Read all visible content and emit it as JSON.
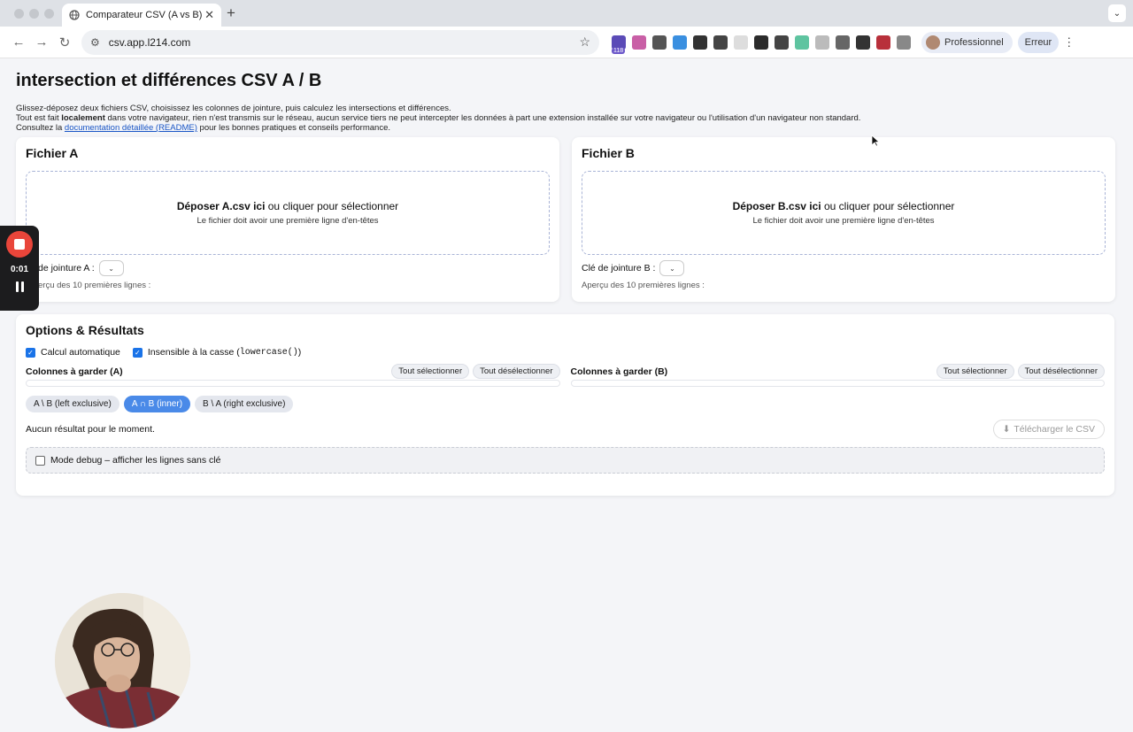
{
  "browser": {
    "tab_title": "Comparateur CSV (A vs B)",
    "url": "csv.app.l214.com",
    "profile_label": "Professionnel",
    "error_label": "Erreur",
    "extension_badge": "118"
  },
  "page": {
    "title": "intersection et différences CSV A / B",
    "intro_line1": "Glissez-déposez deux fichiers CSV, choisissez les colonnes de jointure, puis calculez les intersections et différences.",
    "intro_line2_prefix": "Tout est fait ",
    "intro_line2_bold": "localement",
    "intro_line2_suffix": " dans votre navigateur, rien n'est transmis sur le réseau, aucun service tiers ne peut intercepter les données à part une extension installée sur votre navigateur ou l'utilisation d'un navigateur non standard.",
    "intro_line3_prefix": "Consultez la ",
    "intro_line3_link": "documentation détaillée (README)",
    "intro_line3_suffix": " pour les bonnes pratiques et conseils performance."
  },
  "file_a": {
    "heading": "Fichier A",
    "drop_bold": "Déposer A.csv ici",
    "drop_rest": " ou cliquer pour sélectionner",
    "drop_hint": "Le fichier doit avoir une première ligne d'en-têtes",
    "key_label": "de jointure A :",
    "preview_label": "erçu des 10 premières lignes :"
  },
  "file_b": {
    "heading": "Fichier B",
    "drop_bold": "Déposer B.csv ici",
    "drop_rest": " ou cliquer pour sélectionner",
    "drop_hint": "Le fichier doit avoir une première ligne d'en-têtes",
    "key_label": "Clé de jointure B :",
    "preview_label": "Aperçu des 10 premières lignes :"
  },
  "options": {
    "heading": "Options & Résultats",
    "auto_calc_label": "Calcul automatique",
    "auto_calc_checked": true,
    "case_label": "Insensible à la casse (",
    "case_code": "lowercase()",
    "case_label_end": ")",
    "case_checked": true,
    "cols_a_label": "Colonnes à garder (A)",
    "cols_b_label": "Colonnes à garder (B)",
    "select_all": "Tout sélectionner",
    "deselect_all": "Tout désélectionner",
    "modes": [
      "A \\ B (left exclusive)",
      "A ∩ B (inner)",
      "B \\ A (right exclusive)"
    ],
    "active_mode": "A ∩ B (inner)",
    "no_result": "Aucun résultat pour le moment.",
    "download_label": "Télécharger le CSV",
    "debug_label": "Mode debug – afficher les lignes sans clé",
    "debug_checked": false
  },
  "recorder": {
    "time": "0:01"
  },
  "colors": {
    "accent": "#1a73e8",
    "active_mode": "#4a8ae8",
    "record": "#e9453a"
  }
}
